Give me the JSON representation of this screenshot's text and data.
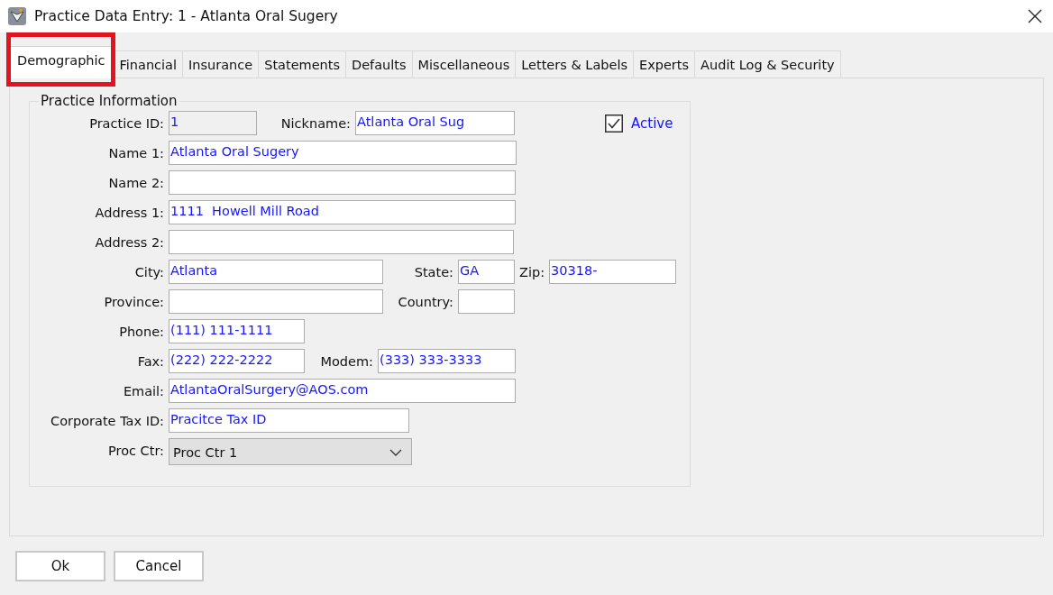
{
  "window": {
    "title": "Practice Data Entry: 1 - Atlanta Oral Sugery"
  },
  "tabs": [
    {
      "label": "Demographic",
      "selected": true,
      "highlighted": true
    },
    {
      "label": "Financial",
      "selected": false,
      "highlighted": false
    },
    {
      "label": "Insurance",
      "selected": false,
      "highlighted": false
    },
    {
      "label": "Statements",
      "selected": false,
      "highlighted": false
    },
    {
      "label": "Defaults",
      "selected": false,
      "highlighted": false
    },
    {
      "label": "Miscellaneous",
      "selected": false,
      "highlighted": false
    },
    {
      "label": "Letters & Labels",
      "selected": false,
      "highlighted": false
    },
    {
      "label": "Experts",
      "selected": false,
      "highlighted": false
    },
    {
      "label": "Audit Log & Security",
      "selected": false,
      "highlighted": false
    }
  ],
  "group": {
    "title": "Practice Information",
    "rows": [
      [
        {
          "kind": "label",
          "text": "Practice ID:"
        },
        {
          "kind": "field",
          "value": "1",
          "disabled": true
        },
        {
          "kind": "label",
          "text": "Nickname:"
        },
        {
          "kind": "field",
          "value": "Atlanta Oral Sug",
          "disabled": false
        },
        {
          "kind": "checkbox",
          "label": "Active",
          "checked": true
        }
      ],
      [
        {
          "kind": "label",
          "text": "Name 1:"
        },
        {
          "kind": "field",
          "value": "Atlanta Oral Sugery",
          "disabled": false
        }
      ],
      [
        {
          "kind": "label",
          "text": "Name 2:"
        },
        {
          "kind": "field",
          "disabled": false
        }
      ],
      [
        {
          "kind": "label",
          "text": "Address 1:"
        },
        {
          "kind": "field",
          "value": "1111  Howell Mill Road",
          "disabled": false
        }
      ],
      [
        {
          "kind": "label",
          "text": "Address 2:"
        },
        {
          "kind": "field",
          "disabled": false
        }
      ],
      [
        {
          "kind": "label",
          "text": "City:"
        },
        {
          "kind": "field",
          "value": "Atlanta",
          "disabled": false
        },
        {
          "kind": "label",
          "text": "State:"
        },
        {
          "kind": "field",
          "value": "GA",
          "disabled": false
        },
        {
          "kind": "label",
          "text": "Zip:"
        },
        {
          "kind": "field",
          "value": "30318-",
          "disabled": false
        }
      ],
      [
        {
          "kind": "label",
          "text": "Province:"
        },
        {
          "kind": "field",
          "disabled": false
        },
        {
          "kind": "label",
          "text": "Country:"
        },
        {
          "kind": "field",
          "disabled": false
        }
      ],
      [
        {
          "kind": "label",
          "text": "Phone:"
        },
        {
          "kind": "field",
          "value": "(111) 111-1111",
          "disabled": false
        }
      ],
      [
        {
          "kind": "label",
          "text": "Fax:"
        },
        {
          "kind": "field",
          "value": "(222) 222-2222",
          "disabled": false
        },
        {
          "kind": "label",
          "text": "Modem:"
        },
        {
          "kind": "field",
          "value": "(333) 333-3333",
          "disabled": false
        }
      ],
      [
        {
          "kind": "label",
          "text": "Email:"
        },
        {
          "kind": "field",
          "value": "AtlantaOralSurgery@AOS.com",
          "disabled": false
        }
      ],
      [
        {
          "kind": "label",
          "text": "Corporate Tax ID:"
        },
        {
          "kind": "field",
          "value": "Pracitce Tax ID",
          "disabled": false
        }
      ],
      [
        {
          "kind": "label",
          "text": "Proc Ctr:"
        },
        {
          "kind": "select",
          "value": "Proc Ctr 1"
        }
      ]
    ]
  },
  "buttons": [
    {
      "label": "Ok"
    },
    {
      "label": "Cancel"
    }
  ]
}
